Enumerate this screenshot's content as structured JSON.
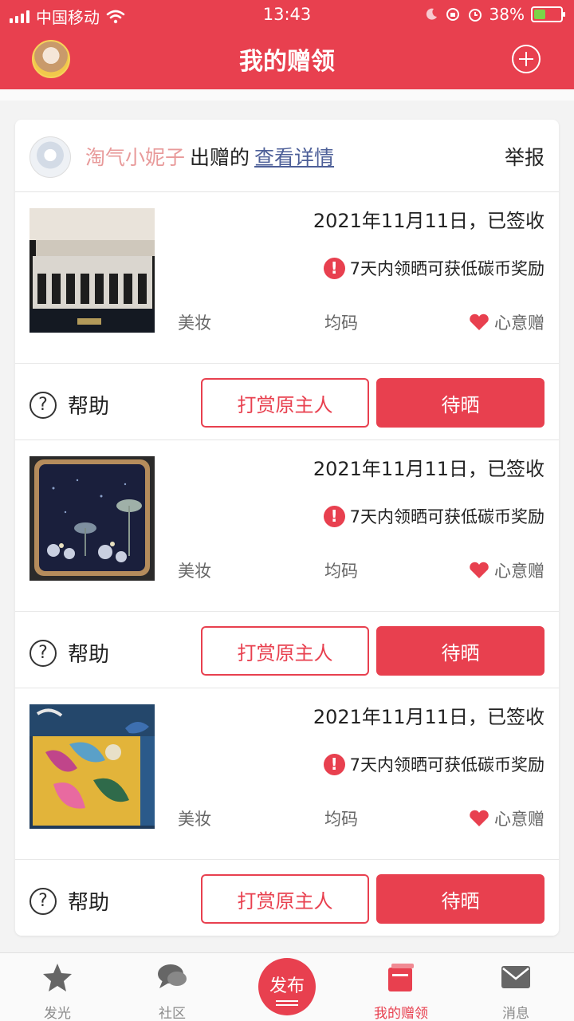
{
  "status_bar": {
    "carrier": "中国移动",
    "time": "13:43",
    "battery": "38%"
  },
  "header": {
    "title": "我的赠领"
  },
  "donor": {
    "name": "淘气小妮子",
    "text": "出赠的",
    "link": "查看详情",
    "report": "举报"
  },
  "items": [
    {
      "date": "2021年11月11日，已签收",
      "reward": "7天内领晒可获低碳币奖励",
      "category": "美妆",
      "size": "均码",
      "gift_type": "心意赠",
      "help": "帮助",
      "tip_button": "打赏原主人",
      "show_button": "待晒"
    },
    {
      "date": "2021年11月11日，已签收",
      "reward": "7天内领晒可获低碳币奖励",
      "category": "美妆",
      "size": "均码",
      "gift_type": "心意赠",
      "help": "帮助",
      "tip_button": "打赏原主人",
      "show_button": "待晒"
    },
    {
      "date": "2021年11月11日，已签收",
      "reward": "7天内领晒可获低碳币奖励",
      "category": "美妆",
      "size": "均码",
      "gift_type": "心意赠",
      "help": "帮助",
      "tip_button": "打赏原主人",
      "show_button": "待晒"
    }
  ],
  "tabbar": {
    "tabs": [
      "发光",
      "社区",
      "发布",
      "我的赠领",
      "消息"
    ],
    "active": "我的赠领"
  },
  "colors": {
    "accent": "#e8404f",
    "donor_name": "#e89a9a",
    "link": "#4d5f98"
  }
}
